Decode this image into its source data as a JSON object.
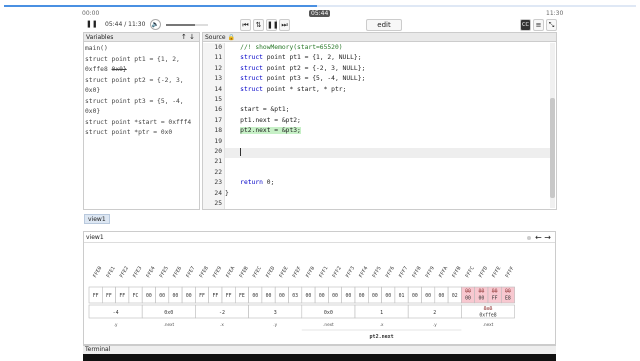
{
  "timeline": {
    "elapsed": "00:00",
    "total": "11:30",
    "hover_time": "05:44",
    "progress": 0.496
  },
  "controls": {
    "play_icon": "pause-icon",
    "time_display": "05:44 / 11:30",
    "volume_icon": "volume-icon",
    "volume_level": 0.7,
    "edit_label": "edit",
    "cc_label": "CC"
  },
  "variables": {
    "title": "Variables",
    "lines": [
      "main()",
      "  struct point pt1 = {1, 2,",
      "  0xffe8 0x0}",
      "  struct point pt2 = {-2, 3,",
      "  0x0}",
      "  struct point pt3 = {5, -4,",
      "  0x0}",
      "  struct point *start = 0xfff4",
      "  struct point *ptr = 0x0"
    ]
  },
  "source": {
    "title": "Source",
    "lines": [
      {
        "n": "10",
        "text": "    //! showMemory(start=65520)",
        "hl": false
      },
      {
        "n": "11",
        "text": "    struct point pt1 = {1, 2, NULL};",
        "hl": false
      },
      {
        "n": "12",
        "text": "    struct point pt2 = {-2, 3, NULL};",
        "hl": false
      },
      {
        "n": "13",
        "text": "    struct point pt3 = {5, -4, NULL};",
        "hl": false
      },
      {
        "n": "14",
        "text": "    struct point * start, * ptr;",
        "hl": false
      },
      {
        "n": "15",
        "text": "",
        "hl": false
      },
      {
        "n": "16",
        "text": "    start = &pt1;",
        "hl": false
      },
      {
        "n": "17",
        "text": "    pt1.next = &pt2;",
        "hl": false
      },
      {
        "n": "18",
        "text": "    pt2.next = &pt3;",
        "hl": true
      },
      {
        "n": "19",
        "text": "",
        "hl": false
      },
      {
        "n": "20",
        "text": "    ",
        "hl": false,
        "cursor": true
      },
      {
        "n": "21",
        "text": "",
        "hl": false
      },
      {
        "n": "22",
        "text": "",
        "hl": false
      },
      {
        "n": "23",
        "text": "    return 0;",
        "hl": false
      },
      {
        "n": "24",
        "text": "}",
        "hl": false
      },
      {
        "n": "25",
        "text": "",
        "hl": false
      }
    ]
  },
  "view_tab": "view1",
  "view": {
    "title": "view1",
    "addresses": [
      "FFE0",
      "FFE1",
      "FFE2",
      "FFE3",
      "FFE4",
      "FFE5",
      "FFE6",
      "FFE7",
      "FFE8",
      "FFE9",
      "FFEA",
      "FFEB",
      "FFEC",
      "FFED",
      "FFEE",
      "FFEF",
      "FFF0",
      "FFF1",
      "FFF2",
      "FFF3",
      "FFF4",
      "FFF5",
      "FFF6",
      "FFF7",
      "FFF8",
      "FFF9",
      "FFFA",
      "FFFB",
      "FFFC",
      "FFFD",
      "FFFE",
      "FFFF"
    ],
    "bytes": [
      "FF",
      "FF",
      "FF",
      "FC",
      "00",
      "00",
      "00",
      "00",
      "FF",
      "FF",
      "FF",
      "FE",
      "00",
      "00",
      "00",
      "03",
      "00",
      "00",
      "00",
      "00",
      "00",
      "00",
      "00",
      "01",
      "00",
      "00",
      "00",
      "02",
      "00",
      "00",
      "FF",
      "E8"
    ],
    "changed_from": 28,
    "old_bytes": [
      "00",
      "00",
      "00",
      "00"
    ],
    "groups": [
      {
        "value": "-4",
        "label": ".y",
        "start": 0,
        "len": 4
      },
      {
        "value": "0x0",
        "label": ".next",
        "start": 4,
        "len": 4
      },
      {
        "value": "-2",
        "label": ".x",
        "start": 8,
        "len": 4
      },
      {
        "value": "3",
        "label": ".y",
        "start": 12,
        "len": 4
      },
      {
        "value": "0x0",
        "label": ".next",
        "start": 16,
        "len": 4
      },
      {
        "value": "1",
        "label": ".x",
        "start": 20,
        "len": 4
      },
      {
        "value": "2",
        "label": ".y",
        "start": 24,
        "len": 4
      },
      {
        "value": "0xffe8",
        "old": "0x0",
        "label": ".next",
        "start": 28,
        "len": 4
      }
    ],
    "struct_label": "pt2.next"
  },
  "terminal": {
    "title": "Terminal"
  },
  "colors": {
    "accent": "#4a90e2",
    "highlight": "#c6f0c6",
    "changed": "#f8c8d0",
    "current_line": "#eeeeee"
  }
}
